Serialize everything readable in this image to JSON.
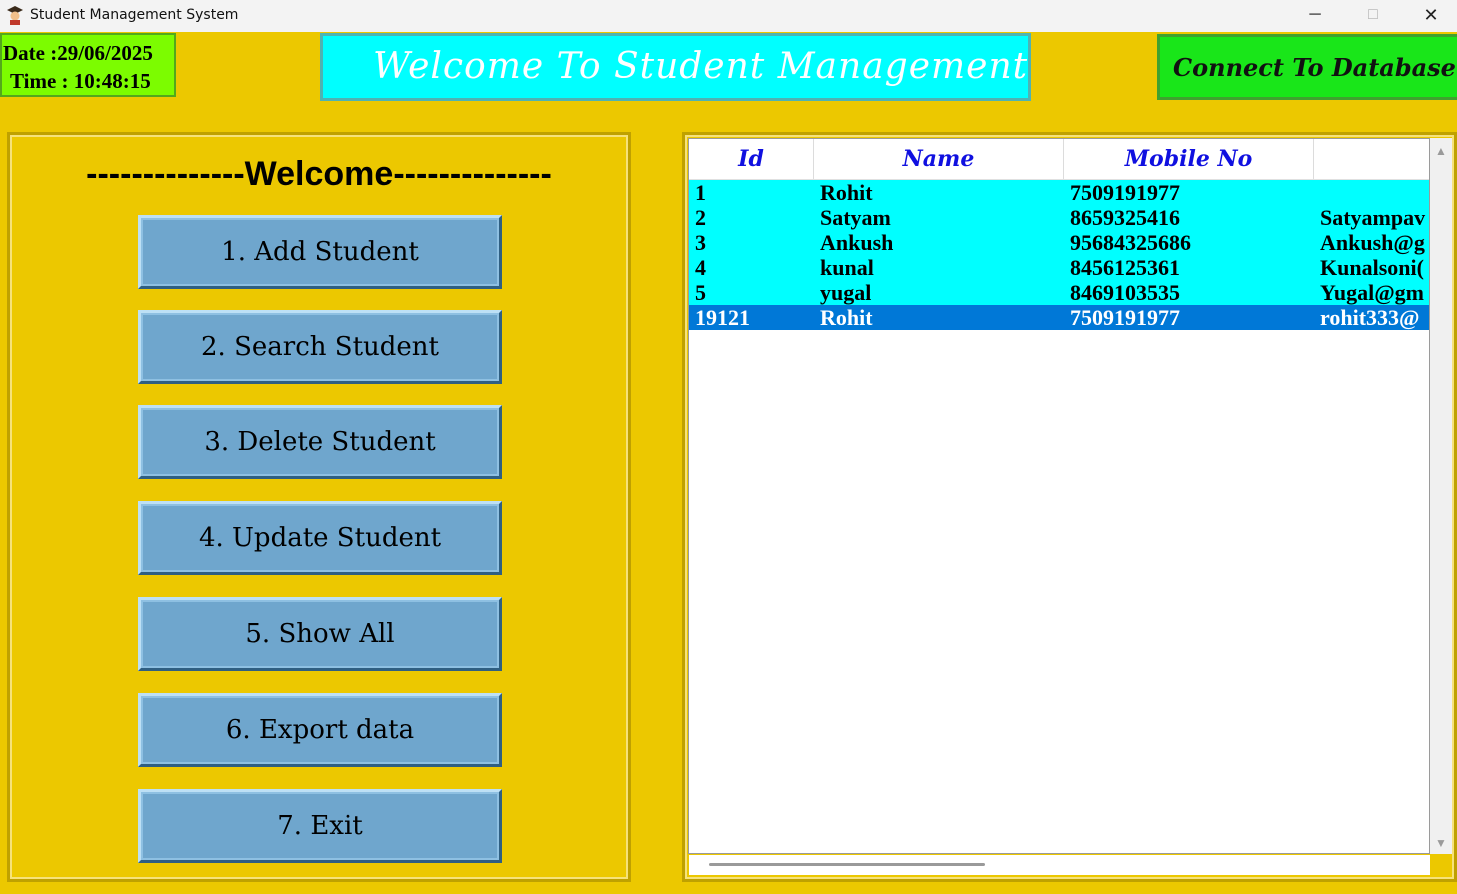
{
  "window": {
    "title": "Student Management System",
    "icon": "graduate-icon",
    "controls": {
      "minimize": "─",
      "maximize": "□",
      "close": "✕"
    }
  },
  "header": {
    "date": "Date :29/06/2025",
    "time": "Time : 10:48:15",
    "banner": "Welcome To Student Management Syst",
    "connect_label": "Connect To Database"
  },
  "menu": {
    "welcome": "--------------Welcome--------------",
    "items": [
      {
        "label": "1. Add Student"
      },
      {
        "label": "2. Search Student"
      },
      {
        "label": "3. Delete Student"
      },
      {
        "label": "4. Update Student"
      },
      {
        "label": "5. Show All"
      },
      {
        "label": "6. Export data"
      },
      {
        "label": "7.  Exit"
      }
    ]
  },
  "table": {
    "columns": [
      "Id",
      "Name",
      "Mobile No",
      ""
    ],
    "rows": [
      {
        "id": "1",
        "name": "Rohit",
        "mobile": "7509191977",
        "email": "",
        "selected": false
      },
      {
        "id": "2",
        "name": "Satyam",
        "mobile": "8659325416",
        "email": "Satyampav",
        "selected": false
      },
      {
        "id": "3",
        "name": "Ankush",
        "mobile": "95684325686",
        "email": "Ankush@g",
        "selected": false
      },
      {
        "id": "4",
        "name": "kunal",
        "mobile": "8456125361",
        "email": "Kunalsoni(",
        "selected": false
      },
      {
        "id": "5",
        "name": "yugal",
        "mobile": "8469103535",
        "email": "Yugal@gm",
        "selected": false
      },
      {
        "id": "19121",
        "name": "Rohit",
        "mobile": "7509191977",
        "email": "rohit333@",
        "selected": true
      }
    ]
  },
  "colors": {
    "background": "#ecc800",
    "datetime_bg": "#7cfc00",
    "banner_bg": "#00ffff",
    "connect_bg": "#19e619",
    "menu_button_bg": "#6fa6cd",
    "row_bg": "#00ffff",
    "row_selected_bg": "#0078d7",
    "header_text": "#1010e0"
  }
}
